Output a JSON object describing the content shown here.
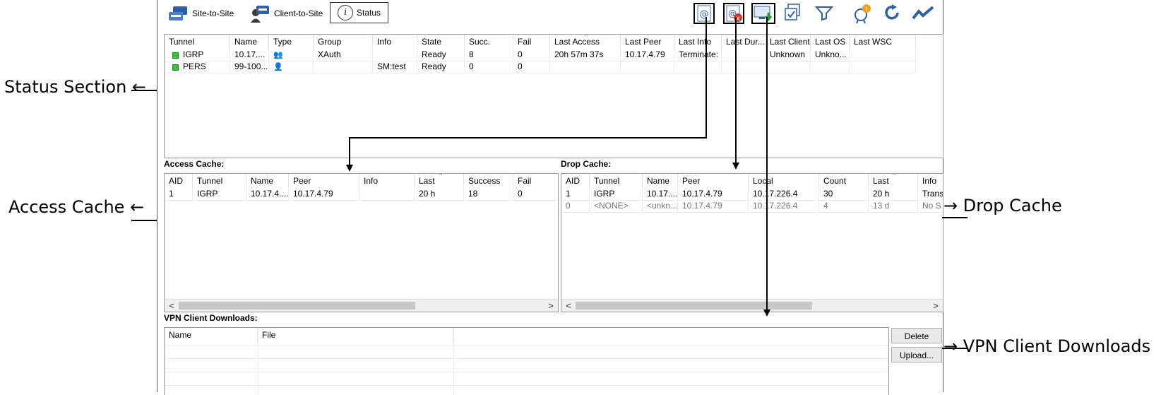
{
  "toolbar": {
    "site_to_site": "Site-to-Site",
    "client_to_site": "Client-to-Site",
    "status": "Status",
    "status_icon_glyph": "i"
  },
  "status_table": {
    "columns": [
      "Tunnel",
      "Name",
      "Type",
      "Group",
      "Info",
      "State",
      "Succ.",
      "Fail",
      "Last Access",
      "Last Peer",
      "Last Info",
      "Last Dur...",
      "Last Client",
      "Last OS",
      "Last WSC"
    ],
    "rows": [
      {
        "tunnel": "IGRP",
        "name": "10.17....",
        "type": "group",
        "group": "XAuth",
        "info": "",
        "state": "Ready",
        "succ": "8",
        "fail": "0",
        "last_access": "20h 57m 37s",
        "last_peer": "10.17.4.79",
        "last_info": "Terminate:",
        "last_dur": "",
        "last_client": "Unknown",
        "last_os": "Unkno...",
        "last_wsc": ""
      },
      {
        "tunnel": "PERS",
        "name": "99-100...",
        "type": "person",
        "group": "",
        "info": "SM:test",
        "state": "Ready",
        "succ": "0",
        "fail": "0",
        "last_access": "",
        "last_peer": "",
        "last_info": "",
        "last_dur": "",
        "last_client": "",
        "last_os": "",
        "last_wsc": ""
      }
    ]
  },
  "access_cache": {
    "title": "Access Cache:",
    "columns": [
      "AID",
      "Tunnel",
      "Name",
      "Peer",
      "Info",
      "Last",
      "Success",
      "Fail"
    ],
    "rows": [
      {
        "aid": "1",
        "tunnel": "IGRP",
        "name": "10.17.4....",
        "peer": "10.17.4.79",
        "info": "",
        "last": "20 h",
        "success": "18",
        "fail": "0"
      }
    ]
  },
  "drop_cache": {
    "title": "Drop Cache:",
    "columns": [
      "AID",
      "Tunnel",
      "Name",
      "Peer",
      "Local",
      "Count",
      "Last",
      "Info"
    ],
    "rows": [
      {
        "aid": "1",
        "tunnel": "IGRP",
        "name": "10.17....",
        "peer": "10.17.4.79",
        "local": "10.17.226.4",
        "count": "30",
        "last": "20 h",
        "info": "Trans"
      },
      {
        "aid": "0",
        "tunnel": "<NONE>",
        "name": "<unkn...",
        "peer": "10.17.4.79",
        "local": "10.17.226.4",
        "count": "4",
        "last": "13 d",
        "info": "No S"
      }
    ]
  },
  "vpn_downloads": {
    "title": "VPN Client Downloads:",
    "columns": [
      "Name",
      "File"
    ],
    "delete_label": "Delete",
    "upload_label": "Upload..."
  },
  "scroll": {
    "left": "<",
    "right": ">"
  },
  "annotations": {
    "status_section": "Status Section",
    "access_cache": "Access Cache",
    "drop_cache": "Drop Cache",
    "vpn_client_downloads": "VPN Client Downloads"
  },
  "colors": {
    "ready_indicator": "#3cbf3c",
    "sort_arrow": "#4a7bc4"
  }
}
